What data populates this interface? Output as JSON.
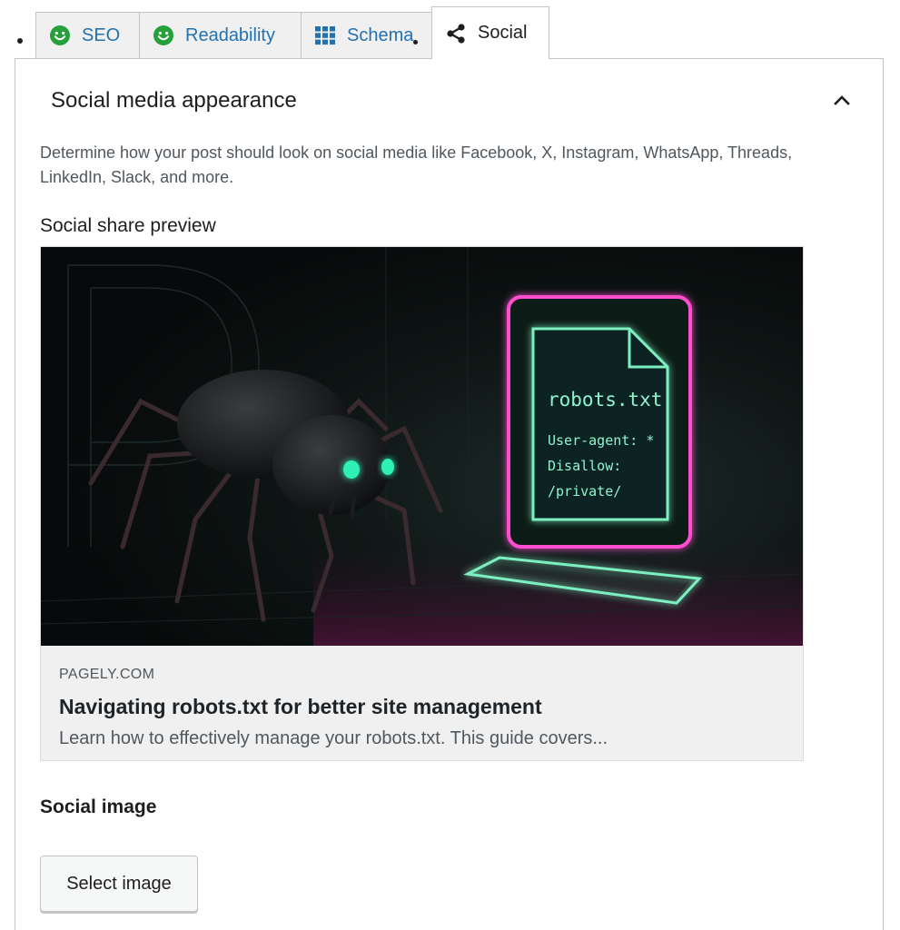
{
  "tabs": [
    {
      "label": "SEO",
      "icon": "smile-icon"
    },
    {
      "label": "Readability",
      "icon": "smile-icon"
    },
    {
      "label": "Schema",
      "icon": "grid-icon"
    },
    {
      "label": "Social",
      "icon": "share-icon"
    }
  ],
  "active_tab": "Social",
  "panel": {
    "title": "Social media appearance",
    "collapse_icon": "chevron-up-icon",
    "description": "Determine how your post should look on social media like Facebook, X, Instagram, WhatsApp, Threads, LinkedIn, Slack, and more.",
    "preview_heading": "Social share preview"
  },
  "preview": {
    "image_text": {
      "filename": "robots.txt",
      "line1": "User-agent: *",
      "line2": "Disallow:",
      "line3": "/private/"
    },
    "domain": "PAGELY.COM",
    "title": "Navigating robots.txt for better site management",
    "description": "Learn how to effectively manage your robots.txt. This guide covers..."
  },
  "social_image": {
    "heading": "Social image",
    "button_label": "Select image"
  },
  "colors": {
    "link": "#2271b1",
    "good_score": "#26a03b",
    "neon_green": "#7cf0c0",
    "neon_pink": "#ff4fd0"
  }
}
